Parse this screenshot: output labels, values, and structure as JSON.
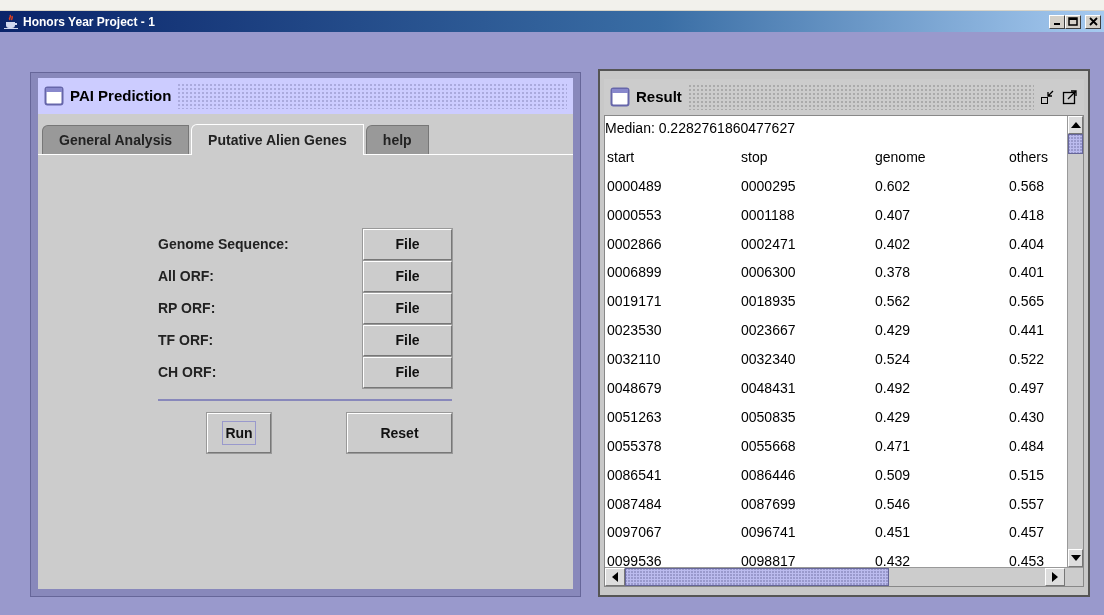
{
  "window": {
    "title": "Honors Year Project - 1"
  },
  "left_frame": {
    "title": "PAI Prediction",
    "tabs": [
      {
        "label": "General Analysis",
        "selected": false
      },
      {
        "label": "Putative Alien Genes",
        "selected": true
      },
      {
        "label": "help",
        "selected": false
      }
    ],
    "inputs": [
      {
        "label": "Genome Sequence:",
        "button": "File"
      },
      {
        "label": "All ORF:",
        "button": "File"
      },
      {
        "label": "RP ORF:",
        "button": "File"
      },
      {
        "label": "TF ORF:",
        "button": "File"
      },
      {
        "label": "CH ORF:",
        "button": "File"
      }
    ],
    "actions": [
      {
        "label": "Run",
        "focused": true
      },
      {
        "label": "Reset",
        "focused": false
      }
    ]
  },
  "right_frame": {
    "title": "Result",
    "median": "Median: 0.2282761860477627",
    "columns": [
      "start",
      "stop",
      "genome",
      "others"
    ],
    "rows": [
      [
        "0000489",
        "0000295",
        "0.602",
        "0.568"
      ],
      [
        "0000553",
        "0001188",
        "0.407",
        "0.418"
      ],
      [
        "0002866",
        "0002471",
        "0.402",
        "0.404"
      ],
      [
        "0006899",
        "0006300",
        "0.378",
        "0.401"
      ],
      [
        "0019171",
        "0018935",
        "0.562",
        "0.565"
      ],
      [
        "0023530",
        "0023667",
        "0.429",
        "0.441"
      ],
      [
        "0032110",
        "0032340",
        "0.524",
        "0.522"
      ],
      [
        "0048679",
        "0048431",
        "0.492",
        "0.497"
      ],
      [
        "0051263",
        "0050835",
        "0.429",
        "0.430"
      ],
      [
        "0055378",
        "0055668",
        "0.471",
        "0.484"
      ],
      [
        "0086541",
        "0086446",
        "0.509",
        "0.515"
      ],
      [
        "0087484",
        "0087699",
        "0.546",
        "0.557"
      ],
      [
        "0097067",
        "0096741",
        "0.451",
        "0.457"
      ],
      [
        "0099536",
        "0098817",
        "0.432",
        "0.453"
      ]
    ]
  }
}
